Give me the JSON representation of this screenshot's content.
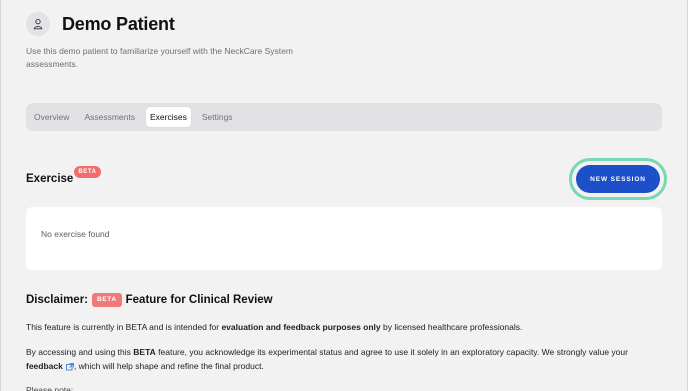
{
  "patient": {
    "name": "Demo Patient",
    "description": "Use this demo patient to familiarize yourself with the NeckCare System assessments."
  },
  "tabs": [
    {
      "label": "Overview",
      "active": false
    },
    {
      "label": "Assessments",
      "active": false
    },
    {
      "label": "Exercises",
      "active": true
    },
    {
      "label": "Settings",
      "active": false
    }
  ],
  "exercise": {
    "title": "Exercise",
    "badge": "BETA",
    "new_session_label": "NEW SESSION",
    "empty_text": "No exercise found"
  },
  "disclaimer": {
    "prefix": "Disclaimer:",
    "badge": "BETA",
    "suffix": "Feature for Clinical Review",
    "p1_a": "This feature is currently in BETA and is intended for ",
    "p1_b": "evaluation and feedback purposes only",
    "p1_c": " by licensed healthcare professionals.",
    "p2_a": "By accessing and using this ",
    "p2_b": "BETA",
    "p2_c": " feature, you acknowledge its experimental status and agree to use it solely in an exploratory capacity. We strongly value your ",
    "p2_link": "feedback",
    "p2_d": ", which will help shape and refine the final product.",
    "p3": "Please note:"
  },
  "colors": {
    "primary": "#1d4fc9",
    "highlight_ring": "#79d8b2",
    "beta_badge": "#f06d6d",
    "background": "#f2f2f3"
  },
  "icons": {
    "avatar": "user-outline-icon",
    "feedback_link": "external-link-icon"
  }
}
